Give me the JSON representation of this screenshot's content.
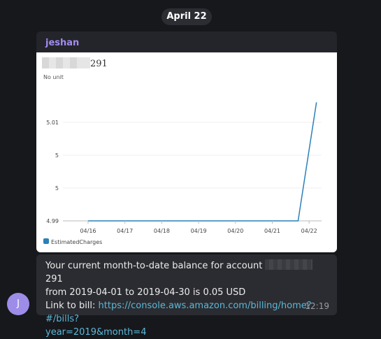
{
  "date_separator": "April 22",
  "message_chart": {
    "sender": "jeshan",
    "chart_title_suffix": "291"
  },
  "chart_data": {
    "type": "line",
    "unit_label": "No unit",
    "y_ticks": [
      "5.01",
      "5",
      "5",
      "4.99"
    ],
    "x_ticks": [
      "04/16",
      "04/17",
      "04/18",
      "04/19",
      "04/20",
      "04/21",
      "04/22"
    ],
    "ylim": [
      4.99,
      5.02
    ],
    "series": [
      {
        "name": "EstimatedCharges",
        "color": "#2a80b9",
        "x": [
          0.0,
          5.7,
          6.2
        ],
        "y": [
          4.99,
          4.99,
          5.0175
        ]
      }
    ],
    "legend_position": "bottom-left",
    "grid": true
  },
  "message_text": {
    "line1_prefix": "Your current month-to-date balance for account",
    "account_suffix": "291",
    "line2": "from 2019-04-01 to 2019-04-30 is 0.05 USD",
    "link_label": "Link to bill:",
    "link_url_part1": "https://console.aws.amazon.com/billing/home?#/bills?",
    "link_url_part2": "year=2019&month=4",
    "time": "12:19"
  },
  "avatar": {
    "initial": "J",
    "color": "#9d8de8"
  }
}
